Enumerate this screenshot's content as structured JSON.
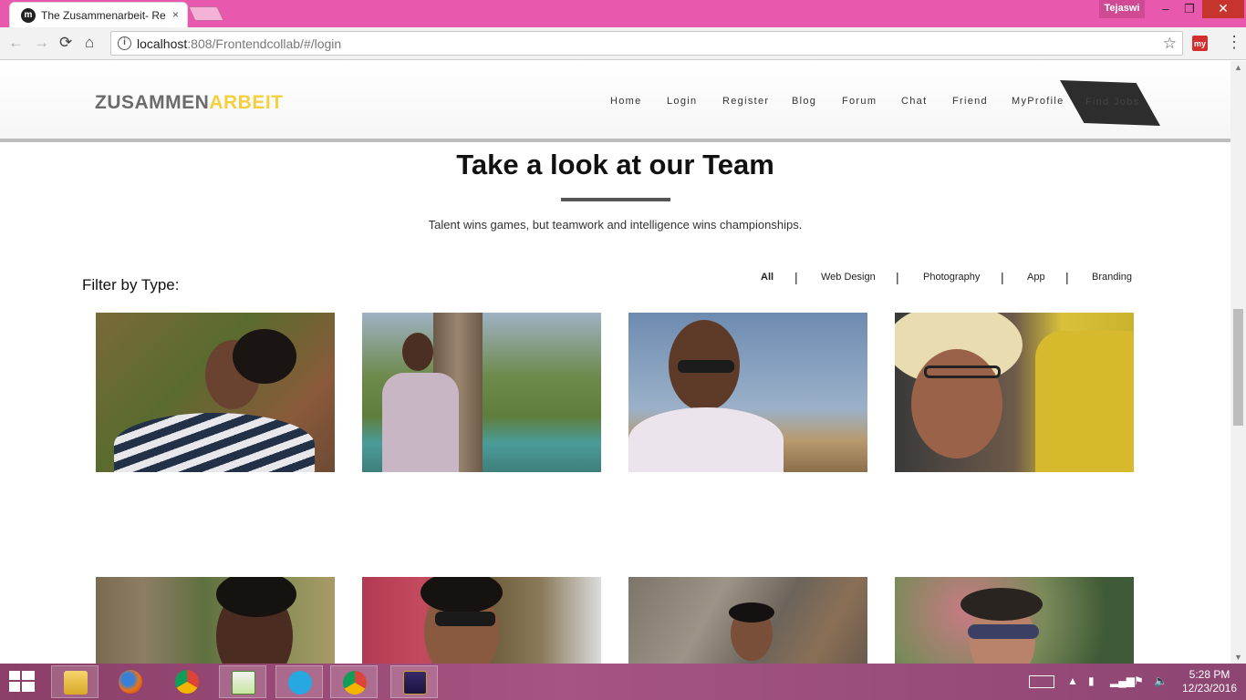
{
  "browser": {
    "tab_title": "The Zusammenarbeit- Re",
    "tab_close": "×",
    "user_name": "Tejaswi",
    "url_host": "localhost",
    "url_rest": ":808/Frontendcollab/#/login",
    "window_min": "–",
    "window_max": "❐",
    "window_close": "✕",
    "extension_label": "my"
  },
  "site": {
    "logo_part1": "ZUSAMMEN",
    "logo_part2": "ARBEIT",
    "logo_color_primary": "#6b6b6b",
    "logo_color_accent": "#f4d03f",
    "nav": [
      "Home",
      "Login",
      "Register",
      "Blog",
      "Forum",
      "Chat",
      "Friend",
      "MyProfile"
    ],
    "find_jobs": "Find Jobs"
  },
  "team": {
    "title_plain": "Take a look at ",
    "title_bold": "our Team",
    "subtitle": "Talent wins games, but teamwork and intelligence wins championships.",
    "filter_label": "Filter by Type:",
    "filters": [
      "All",
      "Web Design",
      "Photography",
      "App",
      "Branding"
    ],
    "filter_separator": "|",
    "active_filter": "All",
    "photos": [
      {
        "name": "team-photo-1",
        "description": "girl in striped top"
      },
      {
        "name": "team-photo-2",
        "description": "man by palm tree"
      },
      {
        "name": "team-photo-3",
        "description": "man with sunglasses"
      },
      {
        "name": "team-photo-4",
        "description": "girl with helmet"
      },
      {
        "name": "team-photo-5",
        "description": "man near tree"
      },
      {
        "name": "team-photo-6",
        "description": "man with sunglasses"
      },
      {
        "name": "team-photo-7",
        "description": "girl by rock"
      },
      {
        "name": "team-photo-8",
        "description": "boy with sunglasses"
      }
    ]
  },
  "taskbar": {
    "apps": [
      "file-explorer",
      "firefox",
      "chrome",
      "notepad-plus-plus",
      "skype",
      "chrome",
      "java-ee-ide"
    ],
    "time": "5:28 PM",
    "date": "12/23/2016"
  }
}
